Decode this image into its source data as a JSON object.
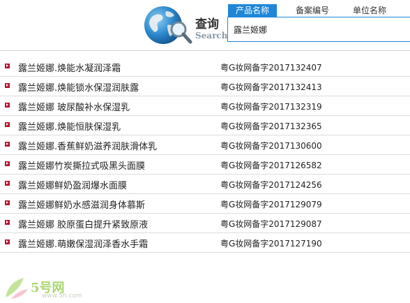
{
  "header": {
    "logo_title": "查询",
    "logo_subtitle": "Search"
  },
  "tabs": [
    {
      "label": "产品名称",
      "active": true
    },
    {
      "label": "备案编号",
      "active": false
    },
    {
      "label": "单位名称",
      "active": false
    }
  ],
  "search": {
    "value": "露兰姬娜"
  },
  "results": [
    {
      "name": "露兰姬娜.焕能水凝润泽霜",
      "reg": "粤G妆网备字2017132407"
    },
    {
      "name": "露兰姬娜.焕能锁水保湿润肤露",
      "reg": "粤G妆网备字2017132413"
    },
    {
      "name": "露兰姬娜 玻尿酸补水保湿乳",
      "reg": "粤G妆网备字2017132319"
    },
    {
      "name": "露兰姬娜.焕能恒肤保湿乳",
      "reg": "粤G妆网备字2017132365"
    },
    {
      "name": "露兰姬娜.香蕉鲜奶滋养润肤滑体乳",
      "reg": "粤G妆网备字2017130600"
    },
    {
      "name": "露兰姬娜竹炭撕拉式吸黑头面膜",
      "reg": "粤G妆网备字2017126582"
    },
    {
      "name": "露兰姬娜鲜奶盈润爆水面膜",
      "reg": "粤G妆网备字2017124256"
    },
    {
      "name": "露兰姬娜鲜奶水感滋润身体慕斯",
      "reg": "粤G妆网备字2017129079"
    },
    {
      "name": "露兰姬娜 胶原蛋白提升紧致原液",
      "reg": "粤G妆网备字2017129087"
    },
    {
      "name": "露兰姬娜.萌嫩保湿润泽香水手霜",
      "reg": "粤G妆网备字2017127190"
    }
  ],
  "watermark": {
    "text": "5号网",
    "url": "www.5h.com"
  },
  "colors": {
    "accent": "#1f86d8",
    "bullet": "#b8112d",
    "divider": "#dcdcdc"
  }
}
